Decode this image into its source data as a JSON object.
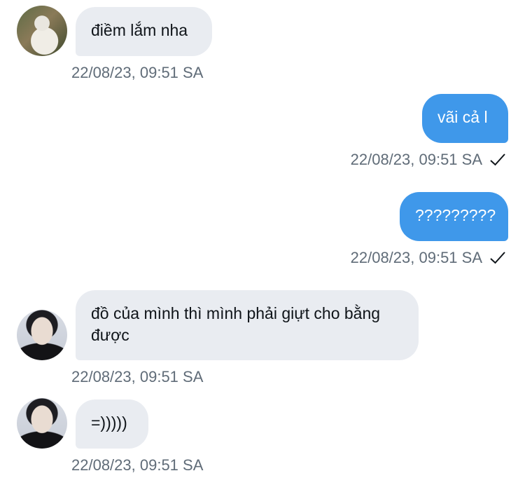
{
  "messages": [
    {
      "direction": "incoming",
      "text": "điềm lắm nha",
      "timestamp": "22/08/23, 09:51 SA"
    },
    {
      "direction": "outgoing",
      "text": "vãi cả l",
      "timestamp": "22/08/23, 09:51 SA",
      "status": "sent-check-icon"
    },
    {
      "direction": "outgoing",
      "text": "?????????",
      "timestamp": "22/08/23, 09:51 SA",
      "status": "sent-check-icon"
    },
    {
      "direction": "incoming",
      "text": "đồ của mình thì mình phải giựt cho bằng được",
      "timestamp": "22/08/23, 09:51 SA"
    },
    {
      "direction": "incoming",
      "text": "=)))))",
      "timestamp": "22/08/23, 09:51 SA"
    }
  ],
  "colors": {
    "incoming_bubble": "#e9ecf1",
    "outgoing_bubble": "#3f98ea",
    "timestamp": "#606c78",
    "text_dark": "#0f1419"
  }
}
